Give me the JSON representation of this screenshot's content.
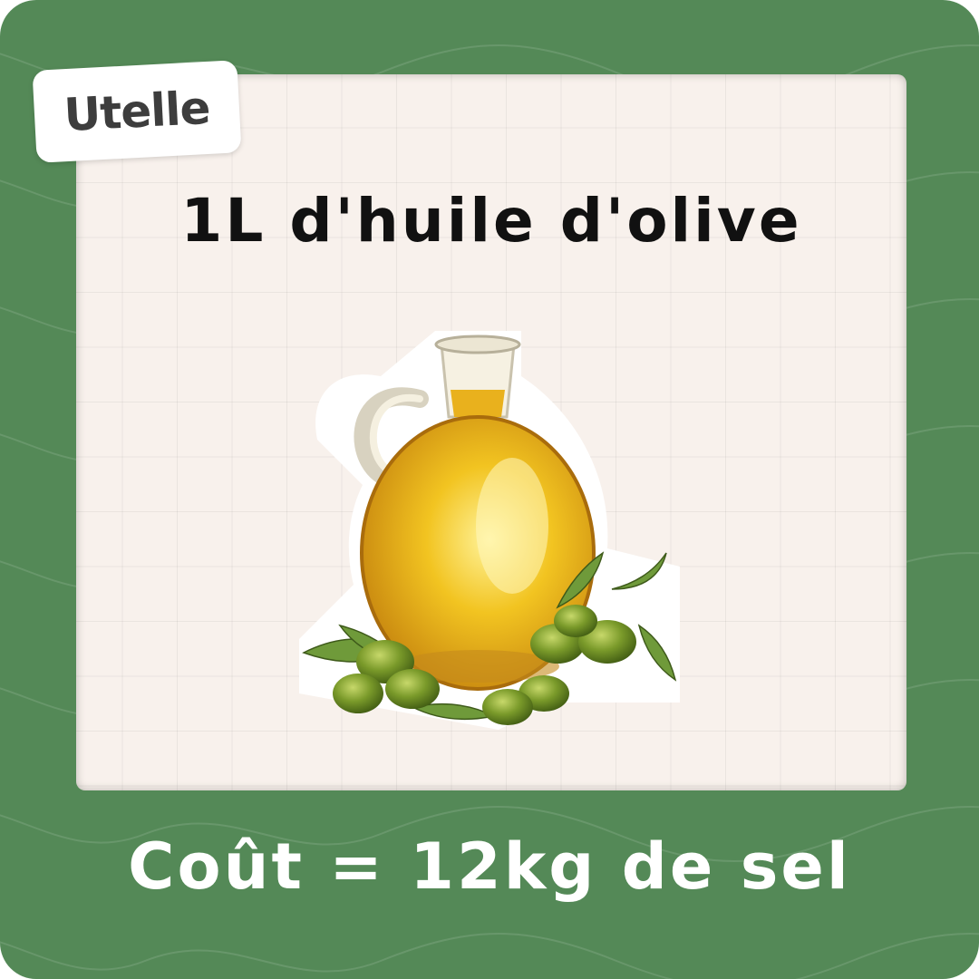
{
  "brand": {
    "name": "Utelle"
  },
  "card": {
    "title": "1L d'huile d'olive",
    "caption": "Coût = 12kg de sel",
    "illustration_icon": "olive-oil-jug-icon"
  },
  "colors": {
    "frame_green": "#548957",
    "panel_cream": "#f8f1ec",
    "oil_gold": "#e8b21c",
    "olive_green": "#7a9a2a"
  }
}
